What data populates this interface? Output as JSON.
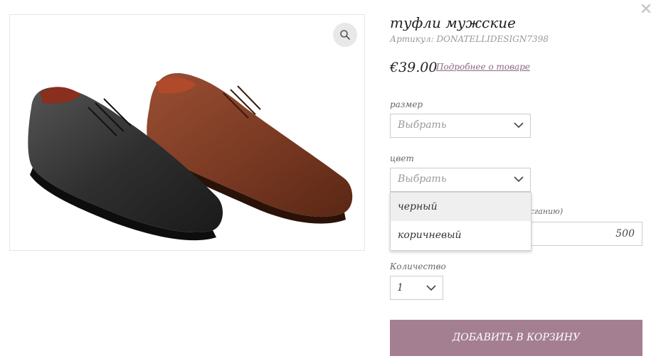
{
  "product": {
    "title": "туфли мужские",
    "sku": "Артикул: DONATELLIDESIGN7398",
    "price": "€39.00",
    "more_link": "Подробнее о товаре"
  },
  "size": {
    "label": "размер",
    "placeholder": "Выбрать"
  },
  "color": {
    "label": "цвет",
    "placeholder": "Выбрать",
    "options": [
      "черный",
      "коричневый"
    ]
  },
  "partial_field": {
    "label_fragment": "ксганию)",
    "value": "500"
  },
  "quantity": {
    "label": "Количество",
    "value": "1"
  },
  "cart": {
    "add_label": "ДОБАВИТЬ В КОРЗИНУ"
  },
  "colors": {
    "accent": "#a47f92",
    "link": "#8a6a7f",
    "black_shoe": "#2b2b2b",
    "brown_shoe": "#7a3a22"
  }
}
